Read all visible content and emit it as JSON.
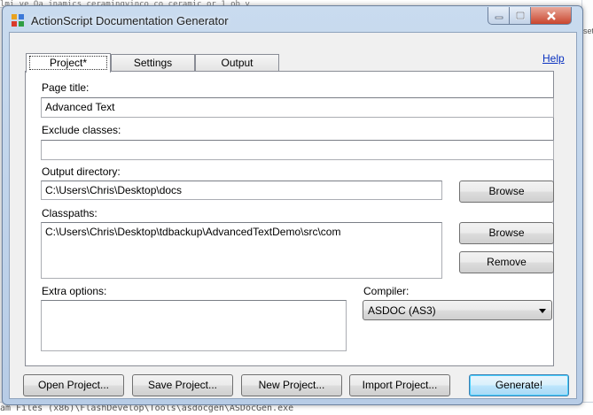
{
  "background": {
    "top_text": "lmi ve Oa jnamics ceramingvinco co ceramic or 1 ob y",
    "bottom_text": "am Files (x86)\\FlashDevelop\\Tools\\asdocgen\\ASDocGen.exe",
    "right_text": "setting"
  },
  "window": {
    "title": "ActionScript Documentation Generator",
    "controls": {
      "minimize": "–",
      "maximize": "□",
      "close": "✕"
    }
  },
  "tabs": [
    {
      "label": "Project*",
      "active": true
    },
    {
      "label": "Settings",
      "active": false
    },
    {
      "label": "Output",
      "active": false
    }
  ],
  "help_link": "Help",
  "project": {
    "page_title_label": "Page title:",
    "page_title_value": "Advanced Text",
    "exclude_classes_label": "Exclude classes:",
    "exclude_classes_value": "",
    "output_directory_label": "Output directory:",
    "output_directory_value": "C:\\Users\\Chris\\Desktop\\docs",
    "output_browse_label": "Browse",
    "classpaths_label": "Classpaths:",
    "classpaths_value": "C:\\Users\\Chris\\Desktop\\tdbackup\\AdvancedTextDemo\\src\\com",
    "classpaths_browse_label": "Browse",
    "classpaths_remove_label": "Remove",
    "extra_options_label": "Extra options:",
    "extra_options_value": "",
    "compiler_label": "Compiler:",
    "compiler_value": "ASDOC (AS3)"
  },
  "footer": {
    "open_project": "Open Project...",
    "save_project": "Save Project...",
    "new_project": "New Project...",
    "import_project": "Import Project...",
    "generate": "Generate!"
  }
}
